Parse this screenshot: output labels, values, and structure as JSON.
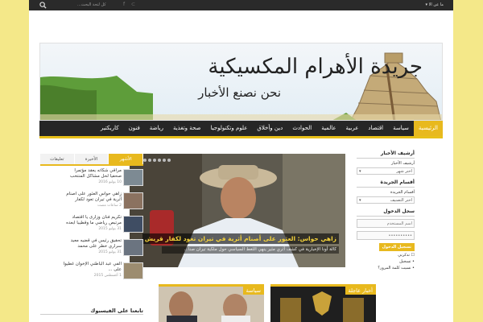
{
  "topbar": {
    "search_placeholder": "...كل لتحة البحث",
    "menu_label": "ما عن الا",
    "social_icons": [
      "facebook-icon",
      "rss-icon"
    ]
  },
  "header": {
    "title": "جريدة الأهرام المكسيكية",
    "slogan": "نحن نصنع الأخبار"
  },
  "nav": {
    "items": [
      "الرئيسية",
      "سياسة",
      "اقتصاد",
      "عربية",
      "عالمية",
      "الحوادث",
      "دين وأخلاق",
      "علوم وتكنولوجيا",
      "صحة وتغذية",
      "رياضة",
      "فنون",
      "كاريكتير"
    ]
  },
  "right_sidebar": {
    "archive_heading": "أرشيف الأخبار",
    "archive_label": "أرشيف الأخبار",
    "archive_select": "اختر شهر",
    "sections_heading": "أقسام الجريدة",
    "sections_label": "أقسام الجريدة",
    "sections_select": "اختر التصنيف",
    "login_heading": "سجل الدخول",
    "username_placeholder": "اسم المستخدم",
    "password_value": "••••••••••",
    "login_button": "تسجيل الدخول",
    "remember_label": "تذكرني",
    "register_link": "تسجيل",
    "forgot_link": "نسيت كلمة المرور؟"
  },
  "slider": {
    "title": "زاهي حواس: العثور على أصنام أثرية في تيران تعود لكفار قريش",
    "excerpt": "كالة أونا الإخبارية في كشف أثري مثير ينهي اللغط السياسي حول ملكية تيران صنا...",
    "dot_count": 8,
    "active_dot": 0
  },
  "left_sidebar": {
    "tabs": [
      "الأشهر",
      "الأخيرة",
      "تعليقات"
    ],
    "active_tab": 0,
    "posts": [
      {
        "title": "مراقي شكاته يعقد مؤتمرا صحفيا لحل مشاكل المنتخب",
        "date": "10 يوليو 2016"
      },
      {
        "title": "زاهي حواس العثور على أصنام أثرية في تيران تعود لكفار قريش",
        "date": "2 ساعات مضت"
      },
      {
        "title": "تكريم فنان وزارى يا اقتصاد مرتبص رياضي ما وقطيبا ابعده عام",
        "date": "31 يوليو 2015"
      },
      {
        "title": "تحقيق رئيس في قضيه معيد سراري خطر على محمد",
        "date": "31 يوليو 2015"
      },
      {
        "title": "الفي عبد الباطني الإخوان غطيوا على ...",
        "date": "1 أغسطس 2015"
      }
    ],
    "facebook_title": "تابعنا على الفيسبوك"
  },
  "category_boxes": [
    {
      "label": "سياسة"
    },
    {
      "label": "أخبار عاجلة"
    }
  ],
  "colors": {
    "accent": "#e8b91e",
    "page_bg": "#f4e889",
    "nav_bg": "#262626"
  }
}
